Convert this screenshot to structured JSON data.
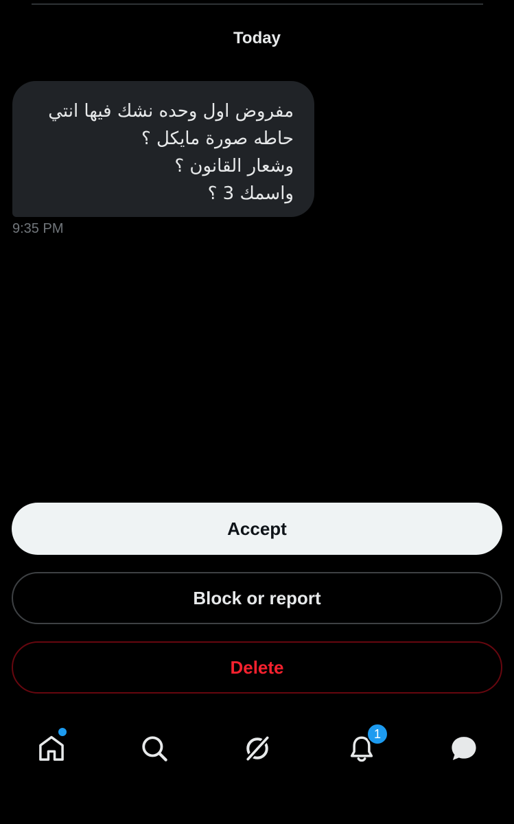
{
  "conversation": {
    "date_label": "Today",
    "message": {
      "lines": [
        "مفروض اول وحده نشك فيها انتي",
        "حاطه صورة مايكل ؟",
        "وشعار القانون ؟",
        "واسمك 3 ؟"
      ],
      "time": "9:35 PM"
    }
  },
  "actions": {
    "accept_label": "Accept",
    "block_label": "Block or report",
    "delete_label": "Delete"
  },
  "nav": {
    "items": [
      {
        "icon": "home-icon",
        "has_dot": true
      },
      {
        "icon": "search-icon"
      },
      {
        "icon": "grok-icon"
      },
      {
        "icon": "bell-icon",
        "badge": "1"
      },
      {
        "icon": "messages-icon"
      }
    ]
  },
  "colors": {
    "background": "#000000",
    "bubble": "#202327",
    "accent": "#1d9bf0",
    "danger": "#f4212e"
  }
}
